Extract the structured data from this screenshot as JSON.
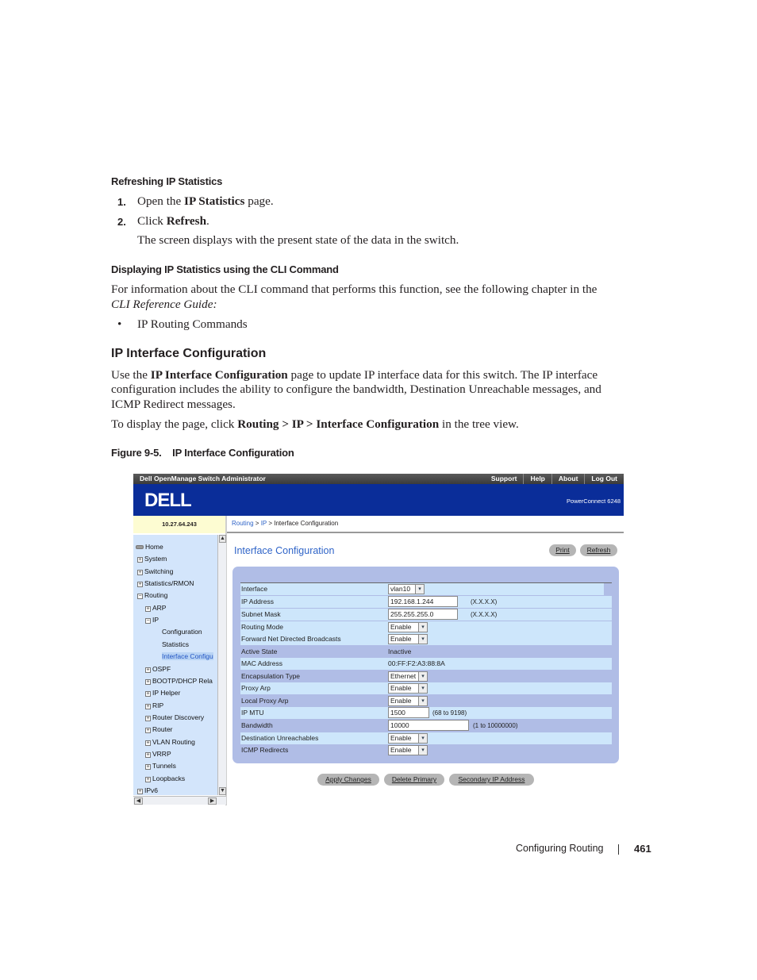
{
  "doc": {
    "h_refresh": "Refreshing IP Statistics",
    "step1_num": "1.",
    "step1_a": "Open the ",
    "step1_b": "IP Statistics",
    "step1_c": " page.",
    "step2_num": "2.",
    "step2_a": "Click ",
    "step2_b": "Refresh",
    "step2_c": ".",
    "step2_note": "The screen displays with the present state of the data in the switch.",
    "h_cli": "Displaying IP Statistics using the CLI Command",
    "cli_p1": "For information about the CLI command that performs this function, see the following chapter in the",
    "cli_p2": "CLI Reference Guide:",
    "bullet_sym": "•",
    "bullet1": "IP Routing Commands",
    "h_section": "IP Interface Configuration",
    "p1_a": "Use the ",
    "p1_b": "IP Interface Configuration",
    "p1_c": " page to update IP interface data for this switch. The IP interface",
    "p1_line2": "configuration includes the ability to configure the bandwidth, Destination Unreachable messages, and",
    "p1_line3": "ICMP Redirect messages.",
    "p2_a": "To display the page, click ",
    "p2_b": "Routing > IP > Interface Configuration",
    "p2_c": " in the tree view.",
    "figure_caption": "Figure 9-5.    IP Interface Configuration",
    "footer_section": "Configuring Routing",
    "footer_page": "461"
  },
  "app": {
    "title": "Dell OpenManage Switch Administrator",
    "top_links": [
      "Support",
      "Help",
      "About",
      "Log Out"
    ],
    "logo": "DELL",
    "model": "PowerConnect 6248",
    "switch_ip": "10.27.64.243",
    "breadcrumb": [
      "Routing",
      "IP",
      "Interface Configuration"
    ],
    "breadcrumb_sep": " > ",
    "tree": [
      {
        "label": "Home",
        "icon": "home-icon"
      },
      {
        "label": "System",
        "icon": "expand-icon"
      },
      {
        "label": "Switching",
        "icon": "expand-icon"
      },
      {
        "label": "Statistics/RMON",
        "icon": "expand-icon"
      },
      {
        "label": "Routing",
        "icon": "collapse-icon"
      },
      {
        "label": "ARP",
        "icon": "expand-icon"
      },
      {
        "label": "IP",
        "icon": "collapse-icon"
      },
      {
        "label": "Configuration",
        "icon": ""
      },
      {
        "label": "Statistics",
        "icon": ""
      },
      {
        "label": "Interface Configu",
        "icon": ""
      },
      {
        "label": "OSPF",
        "icon": "expand-icon"
      },
      {
        "label": "BOOTP/DHCP Rela",
        "icon": "expand-icon"
      },
      {
        "label": "IP Helper",
        "icon": "expand-icon"
      },
      {
        "label": "RIP",
        "icon": "expand-icon"
      },
      {
        "label": "Router Discovery",
        "icon": "expand-icon"
      },
      {
        "label": "Router",
        "icon": "expand-icon"
      },
      {
        "label": "VLAN Routing",
        "icon": "expand-icon"
      },
      {
        "label": "VRRP",
        "icon": "expand-icon"
      },
      {
        "label": "Tunnels",
        "icon": "expand-icon"
      },
      {
        "label": "Loopbacks",
        "icon": "expand-icon"
      },
      {
        "label": "IPv6",
        "icon": "expand-icon"
      }
    ],
    "page_title": "Interface Configuration",
    "print_label": "Print",
    "refresh_label": "Refresh",
    "form": {
      "interface_label": "Interface",
      "interface_value": "vlan10",
      "ip_label": "IP Address",
      "ip_value": "192.168.1.244",
      "ip_hint": "(X.X.X.X)",
      "mask_label": "Subnet Mask",
      "mask_value": "255.255.255.0",
      "mask_hint": "(X.X.X.X)",
      "routing_mode_label": "Routing Mode",
      "routing_mode_value": "Enable",
      "fwd_label": "Forward Net Directed Broadcasts",
      "fwd_value": "Enable",
      "active_label": "Active State",
      "active_value": "Inactive",
      "mac_label": "MAC Address",
      "mac_value": "00:FF:F2:A3:88:8A",
      "encap_label": "Encapsulation Type",
      "encap_value": "Ethernet",
      "proxy_label": "Proxy Arp",
      "proxy_value": "Enable",
      "lproxy_label": "Local Proxy Arp",
      "lproxy_value": "Enable",
      "mtu_label": "IP MTU",
      "mtu_value": "1500",
      "mtu_hint": "(68 to 9198)",
      "bw_label": "Bandwidth",
      "bw_value": "10000",
      "bw_hint": "(1 to 10000000)",
      "dest_label": "Destination Unreachables",
      "dest_value": "Enable",
      "icmp_label": "ICMP Redirects",
      "icmp_value": "Enable"
    },
    "buttons": {
      "apply": "Apply Changes",
      "delete": "Delete Primary",
      "secondary": "Secondary IP Address"
    }
  }
}
